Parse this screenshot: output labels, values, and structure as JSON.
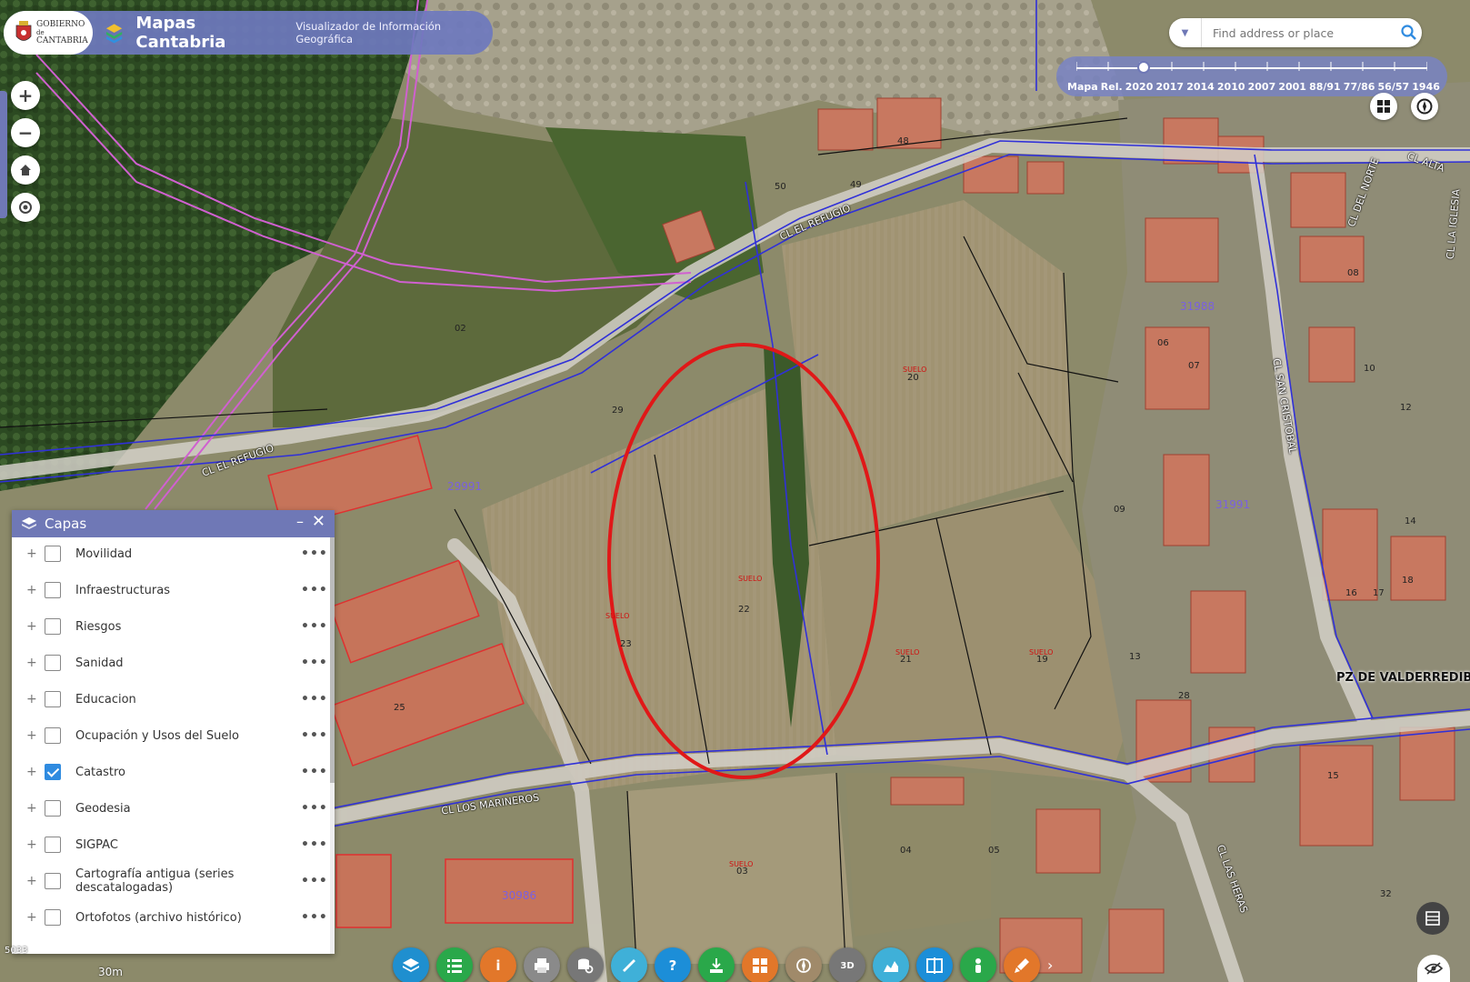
{
  "header": {
    "logo_text": [
      "GOBIERNO",
      "de",
      "CANTABRIA"
    ],
    "title": "Mapas Cantabria",
    "subtitle": "Visualizador de Información Geográfica"
  },
  "search": {
    "placeholder": "Find address or place",
    "icon": "search-icon"
  },
  "timeline": {
    "labels": [
      "Mapa",
      "Rel.",
      "2020",
      "2017",
      "2014",
      "2010",
      "2007",
      "2001",
      "88/91",
      "77/86",
      "56/57",
      "1946"
    ],
    "selected": "2020"
  },
  "zoom_controls": [
    {
      "name": "zoom-in",
      "icon": "plus-icon"
    },
    {
      "name": "zoom-out",
      "icon": "minus-icon"
    },
    {
      "name": "home",
      "icon": "home-icon"
    },
    {
      "name": "locate",
      "icon": "locate-icon"
    }
  ],
  "layers_panel": {
    "title": "Capas",
    "minimize": "–",
    "close": "✕",
    "items": [
      {
        "label": "Movilidad",
        "checked": false
      },
      {
        "label": "Infraestructuras",
        "checked": false
      },
      {
        "label": "Riesgos",
        "checked": false
      },
      {
        "label": "Sanidad",
        "checked": false
      },
      {
        "label": "Educacion",
        "checked": false
      },
      {
        "label": "Ocupación y Usos del Suelo",
        "checked": false
      },
      {
        "label": "Catastro",
        "checked": true
      },
      {
        "label": "Geodesia",
        "checked": false
      },
      {
        "label": "SIGPAC",
        "checked": false
      },
      {
        "label": "Cartografía antigua (series descatalogadas)",
        "checked": false
      },
      {
        "label": "Ortofotos (archivo histórico)",
        "checked": false
      }
    ]
  },
  "map_labels": {
    "streets": [
      "CL EL REFUGIO",
      "CL EL REFUGIO",
      "CL LOS MARINEROS",
      "CL SAN CRISTOBAL",
      "CL LAS HERAS",
      "CL DEL NORTE",
      "CL LA IGLESIA",
      "CL ALTA"
    ],
    "plaza": "PZ DE VALDERREDIBLE",
    "parcels": [
      "22",
      "23",
      "20",
      "21",
      "19",
      "29",
      "03",
      "04",
      "09",
      "02",
      "25",
      "13",
      "12",
      "14",
      "15",
      "16",
      "17",
      "18",
      "28",
      "06",
      "07",
      "08",
      "10",
      "48",
      "49",
      "50",
      "32",
      "05"
    ],
    "suelo": "SUELO",
    "block_ids": [
      "29991",
      "31991",
      "30986",
      "31988"
    ],
    "scale": "30m",
    "edge_coord": "5033"
  },
  "toolbar": [
    {
      "name": "layers-tool",
      "color": "#1f8fcf"
    },
    {
      "name": "legend-tool",
      "color": "#2aa84a"
    },
    {
      "name": "info-tool",
      "color": "#e2772a"
    },
    {
      "name": "print-tool",
      "color": "#8a8a8a"
    },
    {
      "name": "query-tool",
      "color": "#777777"
    },
    {
      "name": "measure-tool",
      "color": "#3fb0d8"
    },
    {
      "name": "help-tool",
      "color": "#1c8ed8"
    },
    {
      "name": "download-tool",
      "color": "#2aa84a"
    },
    {
      "name": "grid-tool",
      "color": "#e2772a"
    },
    {
      "name": "compass-tool",
      "color": "#a08a6a"
    },
    {
      "name": "3d-tool",
      "color": "#777777"
    },
    {
      "name": "profile-tool",
      "color": "#3fb0d8"
    },
    {
      "name": "swipe-tool",
      "color": "#1c8ed8"
    },
    {
      "name": "streetview-tool",
      "color": "#2aa84a"
    },
    {
      "name": "draw-tool",
      "color": "#e2772a"
    }
  ],
  "toolbar_labels": {
    "3d": "3D"
  }
}
